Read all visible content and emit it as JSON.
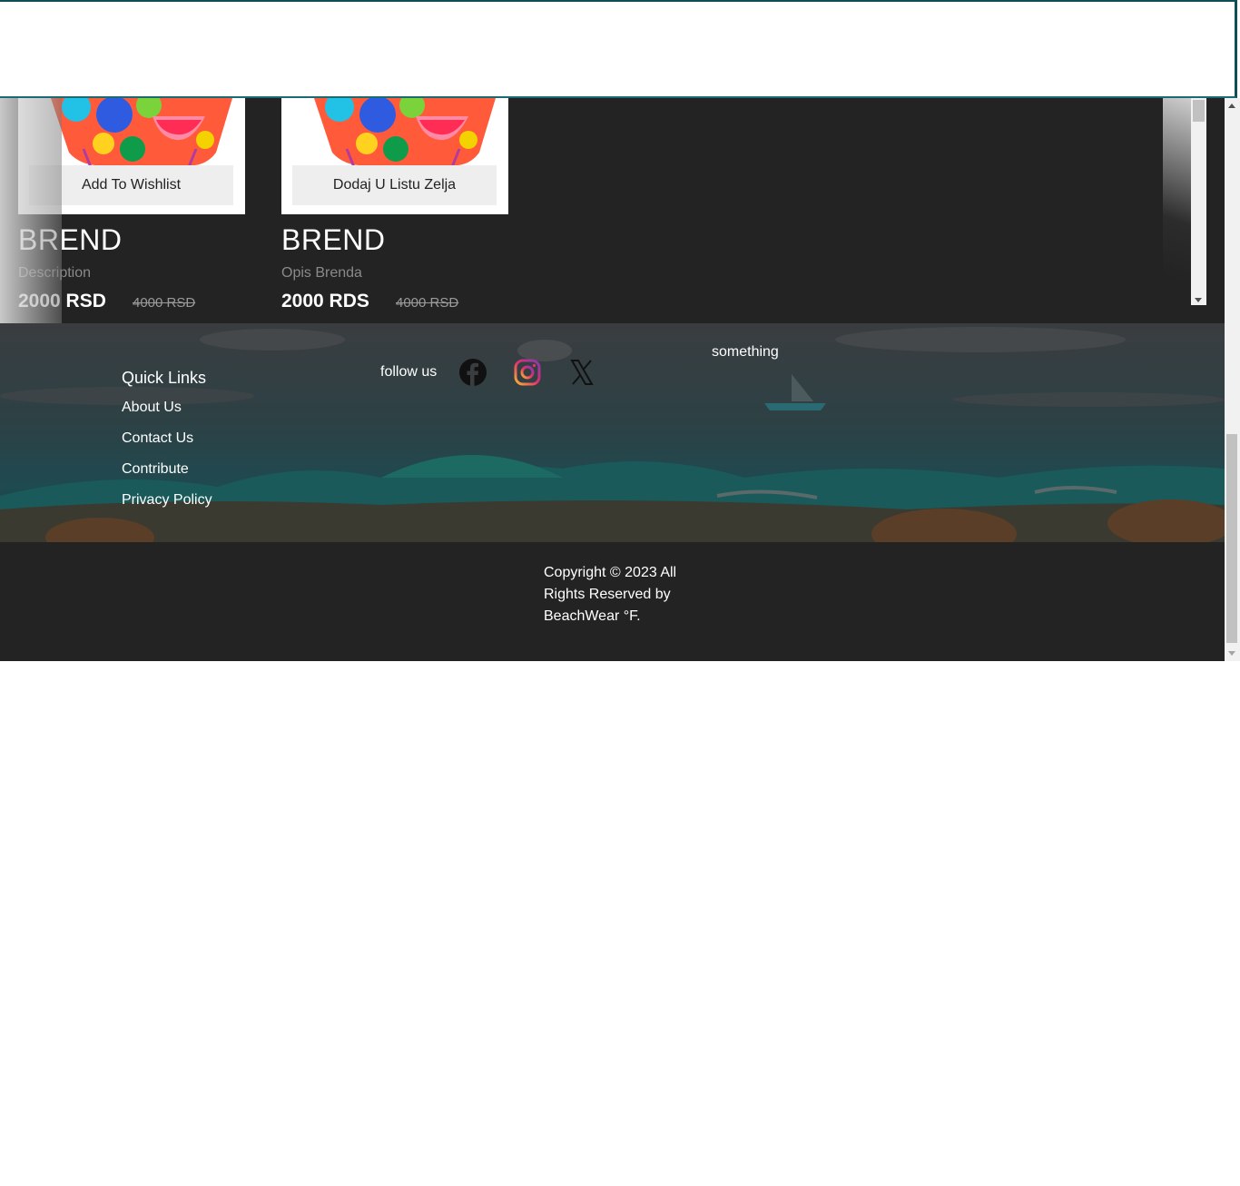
{
  "products": [
    {
      "wishlist_label": "Add To Wishlist",
      "brand": "BREND",
      "description": "Description",
      "price": "2000 RSD",
      "old_price": "4000 RSD"
    },
    {
      "wishlist_label": "Dodaj U Listu Zelja",
      "brand": "BREND",
      "description": "Opis Brenda",
      "price": "2000 RDS",
      "old_price": "4000 RSD"
    }
  ],
  "footer": {
    "quick_links_title": "Quick Links",
    "links": [
      "About Us",
      "Contact Us",
      "Contribute",
      "Privacy Policy"
    ],
    "follow_label": "follow us",
    "social_icons": [
      "facebook-icon",
      "instagram-icon",
      "x-icon"
    ],
    "something": "something",
    "copyright": "Copyright © 2023 All Rights Reserved by BeachWear °F."
  },
  "colors": {
    "header_border": "#0d4f55",
    "dark_bg": "#232323",
    "sea": "#1f4a52"
  }
}
